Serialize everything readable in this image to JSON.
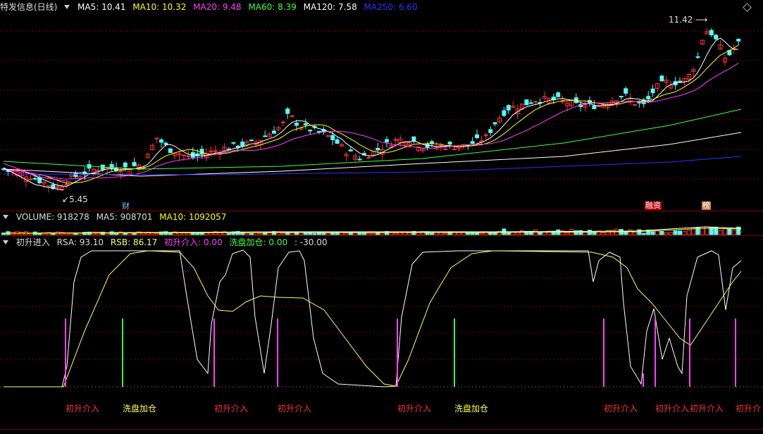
{
  "price_panel": {
    "title": "特发信息(日线)",
    "indicators": [
      {
        "label": "MA5: 10.41",
        "color": "#ffffff"
      },
      {
        "label": "MA10: 10.32",
        "color": "#ffff00"
      },
      {
        "label": "MA20: 9.48",
        "color": "#ff40ff"
      },
      {
        "label": "MA60: 8.39",
        "color": "#40ff40"
      },
      {
        "label": "MA120: 7.58",
        "color": "#ffffff"
      },
      {
        "label": "MA250: 6.60",
        "color": "#3030ff"
      }
    ],
    "high_label": "11.42",
    "low_label": "5.45",
    "tags": [
      {
        "text": "财",
        "bg": "",
        "fg": "#80c0ff"
      },
      {
        "text": "融资",
        "bg": "#c00000",
        "fg": "#ffffff"
      },
      {
        "text": "榜",
        "bg": "#c08040",
        "fg": "#ffffff"
      }
    ]
  },
  "volume_panel": {
    "indicators": [
      {
        "label": "VOLUME: 918278",
        "color": "#dddddd"
      },
      {
        "label": "MA5: 908701",
        "color": "#dddddd"
      },
      {
        "label": "MA10: 1092057",
        "color": "#ffff00"
      }
    ]
  },
  "indicator_panel": {
    "title": "初升进入",
    "indicators": [
      {
        "label": "RSA: 93.10",
        "color": "#dddddd"
      },
      {
        "label": "RSB: 86.17",
        "color": "#ffff60"
      },
      {
        "label": "初升介入: 0.00",
        "color": "#ff40ff"
      },
      {
        "label": "洗盘加仓: 0.00",
        "color": "#40ff40"
      },
      {
        "label": ": -30.00",
        "color": "#dddddd"
      }
    ],
    "signals": [
      {
        "text": "初升介入",
        "type": "entry",
        "color": "#ff3030"
      },
      {
        "text": "洗盘加仓",
        "type": "wash",
        "color": "#ffff40"
      },
      {
        "text": "初升介入",
        "type": "entry",
        "color": "#ff3030"
      },
      {
        "text": "初升介入",
        "type": "entry",
        "color": "#ff3030"
      },
      {
        "text": "初升介入",
        "type": "entry",
        "color": "#ff3030"
      },
      {
        "text": "洗盘加仓",
        "type": "wash",
        "color": "#ffff40"
      },
      {
        "text": "初升介入",
        "type": "entry",
        "color": "#ff3030"
      },
      {
        "text": "初升介入",
        "type": "entry",
        "color": "#ff3030"
      },
      {
        "text": "初升介入",
        "type": "entry",
        "color": "#ff3030"
      },
      {
        "text": "初升介",
        "type": "entry",
        "color": "#ff3030"
      }
    ]
  },
  "colors": {
    "up": "#ff3232",
    "down": "#54ffff",
    "grid": "#7a0000",
    "ma5": "#ffffff",
    "ma10": "#ffff00",
    "ma20": "#ff40ff",
    "ma60": "#40ff40",
    "ma120": "#ffffff",
    "ma250": "#3030ff",
    "entry": "#ff40ff",
    "wash": "#40ff40"
  }
}
